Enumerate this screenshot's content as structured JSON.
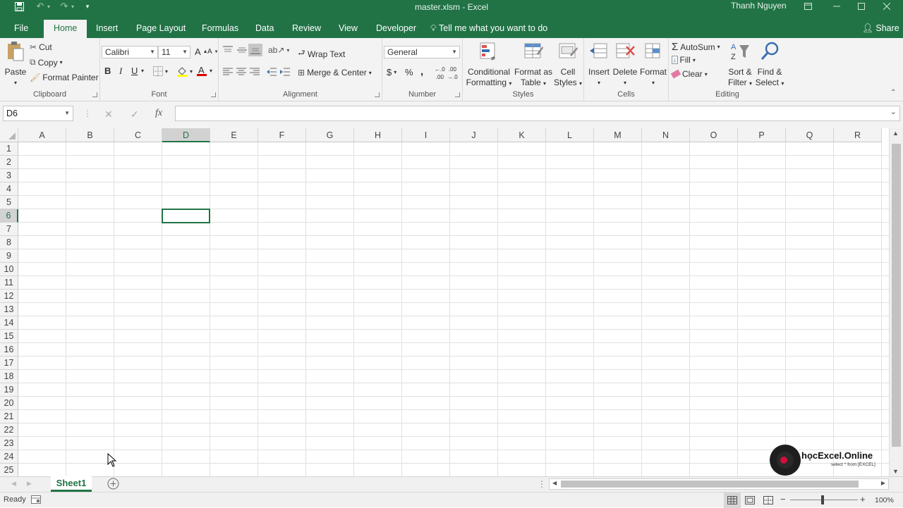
{
  "title_bar": {
    "title": "master.xlsm  -  Excel",
    "user": "Thanh Nguyen"
  },
  "tabs": [
    {
      "label": "File"
    },
    {
      "label": "Home"
    },
    {
      "label": "Insert"
    },
    {
      "label": "Page Layout"
    },
    {
      "label": "Formulas"
    },
    {
      "label": "Data"
    },
    {
      "label": "Review"
    },
    {
      "label": "View"
    },
    {
      "label": "Developer"
    }
  ],
  "active_tab": "Home",
  "tell_me": "Tell me what you want to do",
  "share": "Share",
  "clipboard": {
    "paste": "Paste",
    "cut": "Cut",
    "copy": "Copy",
    "format_painter": "Format Painter",
    "label": "Clipboard"
  },
  "font": {
    "name": "Calibri",
    "size": "11",
    "bold": "B",
    "italic": "I",
    "underline": "U",
    "label": "Font"
  },
  "alignment": {
    "wrap": "Wrap Text",
    "merge": "Merge & Center",
    "label": "Alignment"
  },
  "number": {
    "format": "General",
    "currency": "$",
    "percent": "%",
    "comma": ",",
    "label": "Number"
  },
  "styles": {
    "conditional": [
      "Conditional",
      "Formatting"
    ],
    "format_table": [
      "Format as",
      "Table"
    ],
    "cell_styles": [
      "Cell",
      "Styles"
    ],
    "label": "Styles"
  },
  "cells": {
    "insert": "Insert",
    "delete": "Delete",
    "format": "Format",
    "label": "Cells"
  },
  "editing": {
    "autosum": "AutoSum",
    "fill": "Fill",
    "clear": "Clear",
    "sort": [
      "Sort &",
      "Filter"
    ],
    "find": [
      "Find &",
      "Select"
    ],
    "label": "Editing"
  },
  "formula_bar": {
    "name_box": "D6",
    "fx": "fx",
    "value": ""
  },
  "columns": [
    "A",
    "B",
    "C",
    "D",
    "E",
    "F",
    "G",
    "H",
    "I",
    "J",
    "K",
    "L",
    "M",
    "N",
    "O",
    "P",
    "Q",
    "R"
  ],
  "rows": [
    "1",
    "2",
    "3",
    "4",
    "5",
    "6",
    "7",
    "8",
    "9",
    "10",
    "11",
    "12",
    "13",
    "14",
    "15",
    "16",
    "17",
    "18",
    "19",
    "20",
    "21",
    "22",
    "23",
    "24",
    "25"
  ],
  "selected": {
    "col": "D",
    "row": "6"
  },
  "sheets": [
    {
      "name": "Sheet1"
    }
  ],
  "status": {
    "ready": "Ready",
    "zoom": "100%"
  },
  "watermark": {
    "brand": "họcExcel.Online",
    "tagline": "select * from [EXCEL]"
  },
  "colors": {
    "accent": "#217346"
  }
}
